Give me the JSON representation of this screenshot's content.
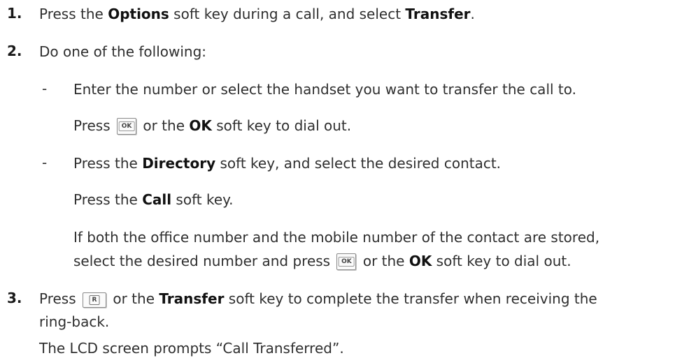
{
  "steps": [
    {
      "num": "1.",
      "parts": [
        "Press the ",
        "Options",
        " soft key during a call, and select ",
        "Transfer",
        "."
      ]
    },
    {
      "num": "2.",
      "text": "Do one of the following:"
    },
    {
      "num": "3.",
      "parts": [
        "Press ",
        " or the ",
        "Transfer",
        " soft key to complete the transfer when receiving the"
      ],
      "cont": "ring-back.",
      "note": "The LCD screen prompts “Call Transferred”."
    }
  ],
  "substeps": [
    {
      "dash": "-",
      "line1": "Enter the number or select the handset you want to transfer the call to.",
      "line2_parts": [
        "Press ",
        " or the ",
        "OK",
        " soft key to dial out."
      ]
    },
    {
      "dash": "-",
      "line1_parts": [
        "Press the ",
        "Directory",
        " soft key, and select the desired contact."
      ],
      "line2_parts": [
        "Press the ",
        "Call",
        " soft key."
      ],
      "line3": "If both the office number and the mobile number of the contact are stored,",
      "line4_parts": [
        "select the desired number and press ",
        " or the ",
        "OK",
        " soft key to dial out."
      ]
    }
  ],
  "keys": {
    "ok": "OK",
    "r": "R"
  }
}
